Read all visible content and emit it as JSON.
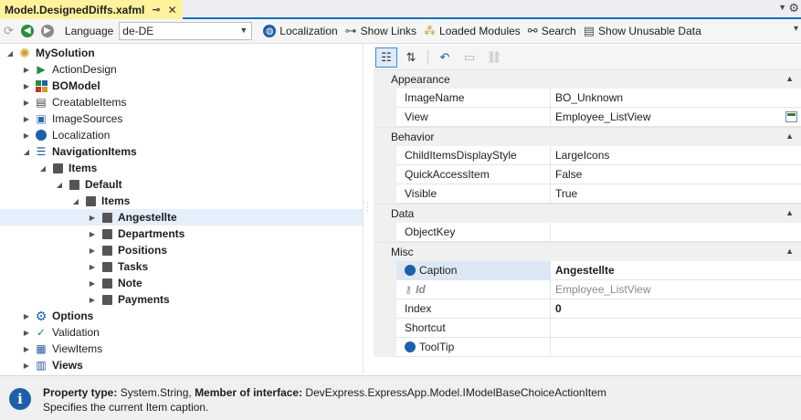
{
  "tab": {
    "title": "Model.DesignedDiffs.xafml",
    "pin_glyph": "⊸",
    "close_glyph": "✕"
  },
  "toolbar": {
    "language_label": "Language",
    "language_value": "de-DE",
    "localization": "Localization",
    "show_links": "Show Links",
    "loaded_modules": "Loaded Modules",
    "search": "Search",
    "show_unusable": "Show Unusable Data"
  },
  "tree": [
    {
      "label": "MySolution",
      "level": 0,
      "expanded": true,
      "bold": true,
      "icon": "gear-icon"
    },
    {
      "label": "ActionDesign",
      "level": 1,
      "expanded": false,
      "bold": false,
      "icon": "action-icon"
    },
    {
      "label": "BOModel",
      "level": 1,
      "expanded": false,
      "bold": true,
      "icon": "bomodel-icon"
    },
    {
      "label": "CreatableItems",
      "level": 1,
      "expanded": false,
      "bold": false,
      "icon": "list-icon"
    },
    {
      "label": "ImageSources",
      "level": 1,
      "expanded": false,
      "bold": false,
      "icon": "image-icon"
    },
    {
      "label": "Localization",
      "level": 1,
      "expanded": false,
      "bold": false,
      "icon": "globe-icon"
    },
    {
      "label": "NavigationItems",
      "level": 1,
      "expanded": true,
      "bold": true,
      "icon": "navigation-icon"
    },
    {
      "label": "Items",
      "level": 2,
      "expanded": true,
      "bold": true,
      "icon": "cube-icon"
    },
    {
      "label": "Default",
      "level": 3,
      "expanded": true,
      "bold": true,
      "icon": "cube-icon"
    },
    {
      "label": "Items",
      "level": 4,
      "expanded": true,
      "bold": true,
      "icon": "cube-icon"
    },
    {
      "label": "Angestellte",
      "level": 5,
      "expanded": false,
      "bold": true,
      "icon": "cube-icon",
      "selected": true
    },
    {
      "label": "Departments",
      "level": 5,
      "expanded": false,
      "bold": true,
      "icon": "cube-icon"
    },
    {
      "label": "Positions",
      "level": 5,
      "expanded": false,
      "bold": true,
      "icon": "cube-icon"
    },
    {
      "label": "Tasks",
      "level": 5,
      "expanded": false,
      "bold": true,
      "icon": "cube-icon"
    },
    {
      "label": "Note",
      "level": 5,
      "expanded": false,
      "bold": true,
      "icon": "cube-icon"
    },
    {
      "label": "Payments",
      "level": 5,
      "expanded": false,
      "bold": true,
      "icon": "cube-icon"
    },
    {
      "label": "Options",
      "level": 1,
      "expanded": false,
      "bold": true,
      "icon": "options-gear-icon"
    },
    {
      "label": "Validation",
      "level": 1,
      "expanded": false,
      "bold": false,
      "icon": "check-icon"
    },
    {
      "label": "ViewItems",
      "level": 1,
      "expanded": false,
      "bold": false,
      "icon": "viewitems-icon"
    },
    {
      "label": "Views",
      "level": 1,
      "expanded": false,
      "bold": true,
      "icon": "views-icon"
    }
  ],
  "property_grid": [
    {
      "type": "category",
      "name": "Appearance"
    },
    {
      "type": "prop",
      "name": "ImageName",
      "value": "BO_Unknown"
    },
    {
      "type": "prop",
      "name": "View",
      "value": "Employee_ListView",
      "editor": true
    },
    {
      "type": "category",
      "name": "Behavior"
    },
    {
      "type": "prop",
      "name": "ChildItemsDisplayStyle",
      "value": "LargeIcons"
    },
    {
      "type": "prop",
      "name": "QuickAccessItem",
      "value": "False"
    },
    {
      "type": "prop",
      "name": "Visible",
      "value": "True"
    },
    {
      "type": "category",
      "name": "Data"
    },
    {
      "type": "prop",
      "name": "ObjectKey",
      "value": ""
    },
    {
      "type": "category",
      "name": "Misc"
    },
    {
      "type": "prop",
      "name": "Caption",
      "value": "Angestellte",
      "icon": "globe-icon",
      "selected": true,
      "bold_value": true
    },
    {
      "type": "prop",
      "name": "Id",
      "value": "Employee_ListView",
      "icon": "key-icon",
      "readonly": true
    },
    {
      "type": "prop",
      "name": "Index",
      "value": "0",
      "bold_value": true
    },
    {
      "type": "prop",
      "name": "Shortcut",
      "value": ""
    },
    {
      "type": "prop",
      "name": "ToolTip",
      "value": "",
      "icon": "globe-icon"
    }
  ],
  "description": {
    "line1_label1": "Property type:",
    "line1_value1": " System.String, ",
    "line1_label2": "Member of interface:",
    "line1_value2": " DevExpress.ExpressApp.Model.IModelBaseChoiceActionItem",
    "line2": "Specifies the current Item caption."
  },
  "colors": {
    "accent": "#0e70c0",
    "tab_active": "#fff29d",
    "selection": "#e5eefb",
    "info": "#1f5fa6"
  }
}
